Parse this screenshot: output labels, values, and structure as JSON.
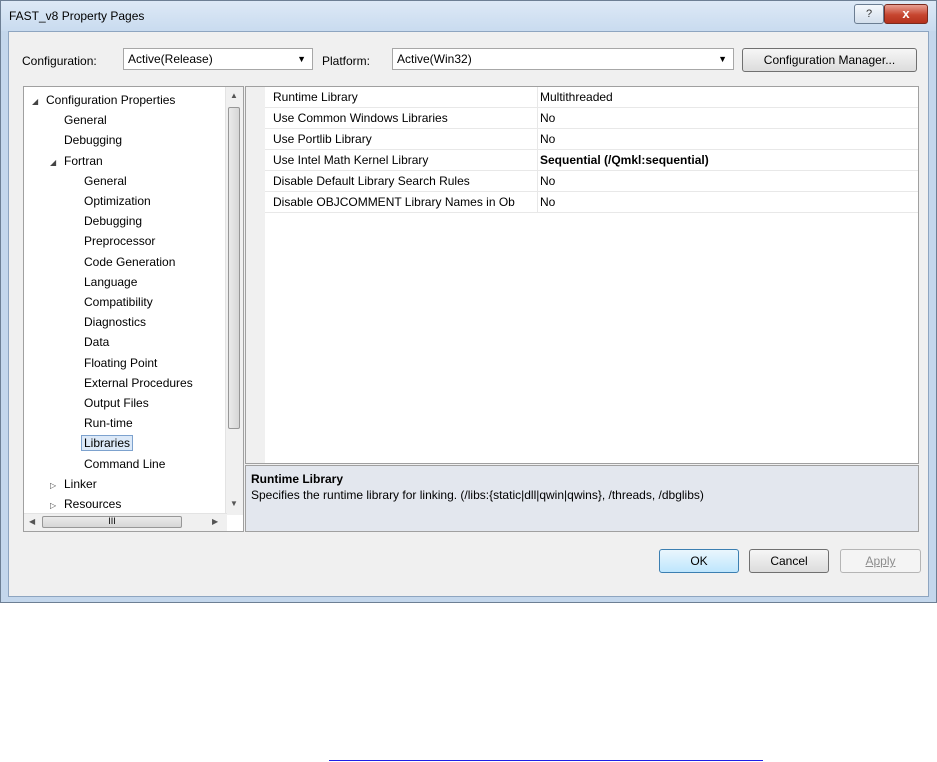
{
  "window": {
    "title": "FAST_v8 Property Pages",
    "help_label": "?",
    "close_label": "x"
  },
  "toolbar": {
    "configuration_label": "Configuration:",
    "configuration_value": "Active(Release)",
    "platform_label": "Platform:",
    "platform_value": "Active(Win32)",
    "config_manager_label": "Configuration Manager..."
  },
  "tree": {
    "items": [
      {
        "label": "Configuration Properties",
        "level": 0,
        "expander": "expanded"
      },
      {
        "label": "General",
        "level": 1,
        "expander": "none"
      },
      {
        "label": "Debugging",
        "level": 1,
        "expander": "none"
      },
      {
        "label": "Fortran",
        "level": 1,
        "expander": "expanded"
      },
      {
        "label": "General",
        "level": 2,
        "expander": "none"
      },
      {
        "label": "Optimization",
        "level": 2,
        "expander": "none"
      },
      {
        "label": "Debugging",
        "level": 2,
        "expander": "none"
      },
      {
        "label": "Preprocessor",
        "level": 2,
        "expander": "none"
      },
      {
        "label": "Code Generation",
        "level": 2,
        "expander": "none"
      },
      {
        "label": "Language",
        "level": 2,
        "expander": "none"
      },
      {
        "label": "Compatibility",
        "level": 2,
        "expander": "none"
      },
      {
        "label": "Diagnostics",
        "level": 2,
        "expander": "none"
      },
      {
        "label": "Data",
        "level": 2,
        "expander": "none"
      },
      {
        "label": "Floating Point",
        "level": 2,
        "expander": "none"
      },
      {
        "label": "External Procedures",
        "level": 2,
        "expander": "none"
      },
      {
        "label": "Output Files",
        "level": 2,
        "expander": "none"
      },
      {
        "label": "Run-time",
        "level": 2,
        "expander": "none"
      },
      {
        "label": "Libraries",
        "level": 2,
        "expander": "none",
        "selected": true
      },
      {
        "label": "Command Line",
        "level": 2,
        "expander": "none"
      },
      {
        "label": "Linker",
        "level": 1,
        "expander": "collapsed"
      },
      {
        "label": "Resources",
        "level": 1,
        "expander": "collapsed"
      }
    ],
    "hscroll_grip": "III"
  },
  "properties": {
    "rows": [
      {
        "name": "Runtime Library",
        "value": "Multithreaded",
        "bold": false
      },
      {
        "name": "Use Common Windows Libraries",
        "value": "No",
        "bold": false
      },
      {
        "name": "Use Portlib Library",
        "value": "No",
        "bold": false
      },
      {
        "name": "Use Intel Math Kernel Library",
        "value": "Sequential (/Qmkl:sequential)",
        "bold": true
      },
      {
        "name": "Disable Default Library Search Rules",
        "value": "No",
        "bold": false
      },
      {
        "name": "Disable OBJCOMMENT Library Names in Ob",
        "value": "No",
        "bold": false
      }
    ]
  },
  "description": {
    "title": "Runtime Library",
    "text": "Specifies the runtime library for linking. (/libs:{static|dll|qwin|qwins}, /threads, /dbglibs)"
  },
  "buttons": {
    "ok_label": "OK",
    "cancel_label": "Cancel",
    "apply_label": "Apply"
  },
  "colors": {
    "title_bar": "#c9dbef",
    "close_button": "#c6452f",
    "selection": "#dce9f8",
    "link": "#1f1fe6"
  }
}
